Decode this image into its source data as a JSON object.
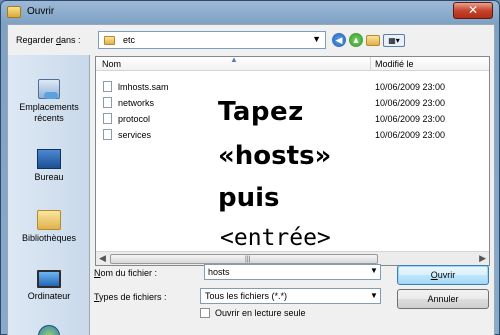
{
  "window": {
    "title": "Ouvrir",
    "close_glyph": "✕"
  },
  "lookin": {
    "label_pre": "Regarder ",
    "label_accel": "d",
    "label_post": "ans :",
    "value": "etc",
    "arrow": "▼"
  },
  "toolbar": {
    "back_glyph": "◀",
    "up_glyph": "▲",
    "view_glyph": "▦▾"
  },
  "places": [
    {
      "label": "Emplacements récents",
      "icon": "recent-places-icon"
    },
    {
      "label": "Bureau",
      "icon": "desktop-icon"
    },
    {
      "label": "Bibliothèques",
      "icon": "libraries-icon"
    },
    {
      "label": "Ordinateur",
      "icon": "computer-icon"
    },
    {
      "label": "",
      "icon": "network-icon"
    }
  ],
  "list": {
    "col_name": "Nom",
    "col_date": "Modifié le",
    "files": [
      {
        "name": "lmhosts.sam",
        "date": "10/06/2009 23:00"
      },
      {
        "name": "networks",
        "date": "10/06/2009 23:00"
      },
      {
        "name": "protocol",
        "date": "10/06/2009 23:00"
      },
      {
        "name": "services",
        "date": "10/06/2009 23:00"
      }
    ]
  },
  "overlay": {
    "line1": "Tapez",
    "line2": "«hosts»",
    "line3": "puis",
    "line4": "<entrée>"
  },
  "filename": {
    "label_accel": "N",
    "label_post": "om du fichier :",
    "value": "hosts"
  },
  "filetype": {
    "label_accel": "T",
    "label_post": "ypes de fichiers :",
    "value": "Tous les fichiers (*.*)"
  },
  "readonly": {
    "label": "Ouvrir en lecture seule"
  },
  "buttons": {
    "open_accel": "O",
    "open_post": "uvrir",
    "cancel": "Annuler"
  },
  "colors": {
    "accent": "#3c7fb1",
    "title_bar": "#7fa2c4",
    "close_red": "#c5452d"
  }
}
